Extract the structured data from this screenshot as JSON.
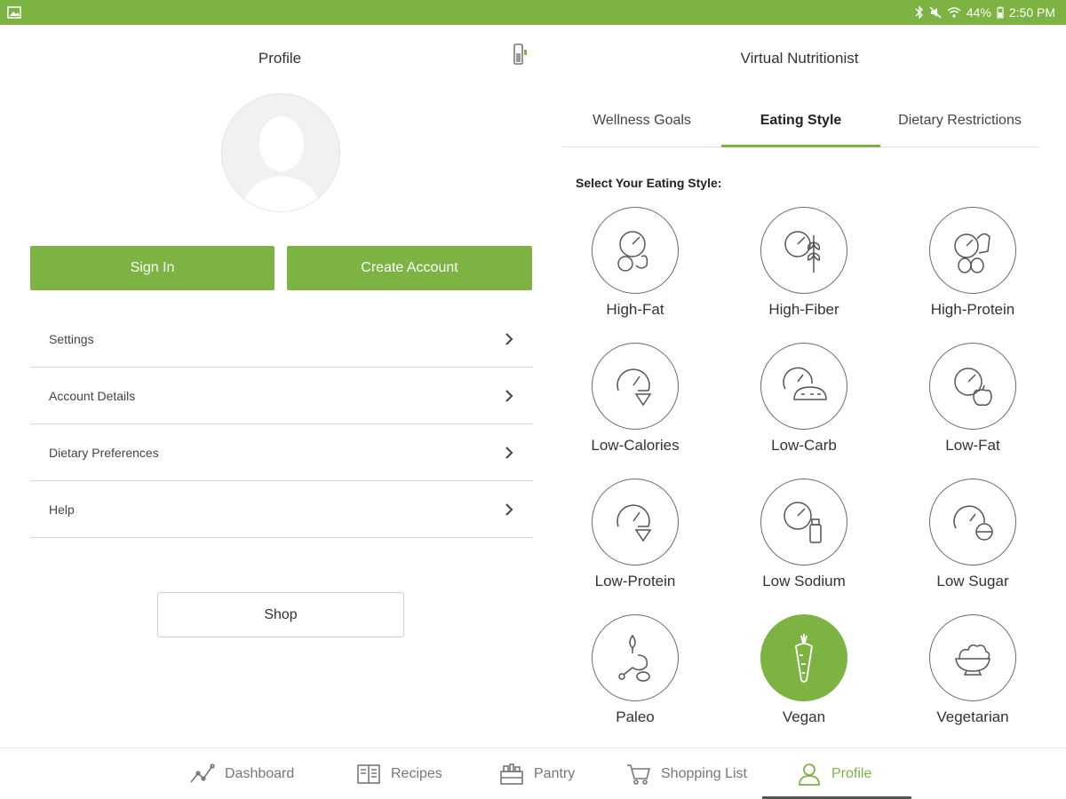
{
  "status_bar": {
    "battery": "44%",
    "time": "2:50 PM"
  },
  "profile": {
    "title": "Profile",
    "sign_in_label": "Sign In",
    "create_account_label": "Create Account",
    "menu": [
      {
        "label": "Settings"
      },
      {
        "label": "Account Details"
      },
      {
        "label": "Dietary Preferences"
      },
      {
        "label": "Help"
      }
    ],
    "shop_label": "Shop"
  },
  "nutritionist": {
    "title": "Virtual Nutritionist",
    "tabs": [
      {
        "label": "Wellness Goals"
      },
      {
        "label": "Eating Style",
        "active": true
      },
      {
        "label": "Dietary Restrictions"
      }
    ],
    "select_label": "Select Your Eating Style:",
    "styles": [
      {
        "label": "High-Fat",
        "icon": "high-fat-icon"
      },
      {
        "label": "High-Fiber",
        "icon": "high-fiber-icon"
      },
      {
        "label": "High-Protein",
        "icon": "high-protein-icon"
      },
      {
        "label": "Low-Calories",
        "icon": "low-calories-icon"
      },
      {
        "label": "Low-Carb",
        "icon": "low-carb-icon"
      },
      {
        "label": "Low-Fat",
        "icon": "low-fat-icon"
      },
      {
        "label": "Low-Protein",
        "icon": "low-protein-icon"
      },
      {
        "label": "Low Sodium",
        "icon": "low-sodium-icon"
      },
      {
        "label": "Low Sugar",
        "icon": "low-sugar-icon"
      },
      {
        "label": "Paleo",
        "icon": "paleo-icon"
      },
      {
        "label": "Vegan",
        "icon": "vegan-icon",
        "selected": true
      },
      {
        "label": "Vegetarian",
        "icon": "vegetarian-icon"
      }
    ]
  },
  "bottom_nav": [
    {
      "label": "Dashboard",
      "icon": "dashboard-icon"
    },
    {
      "label": "Recipes",
      "icon": "recipes-icon"
    },
    {
      "label": "Pantry",
      "icon": "pantry-icon"
    },
    {
      "label": "Shopping List",
      "icon": "cart-icon"
    },
    {
      "label": "Profile",
      "icon": "person-icon",
      "active": true
    }
  ],
  "colors": {
    "accent": "#7cb342",
    "text": "#333333",
    "divider": "#d9d9d9"
  }
}
